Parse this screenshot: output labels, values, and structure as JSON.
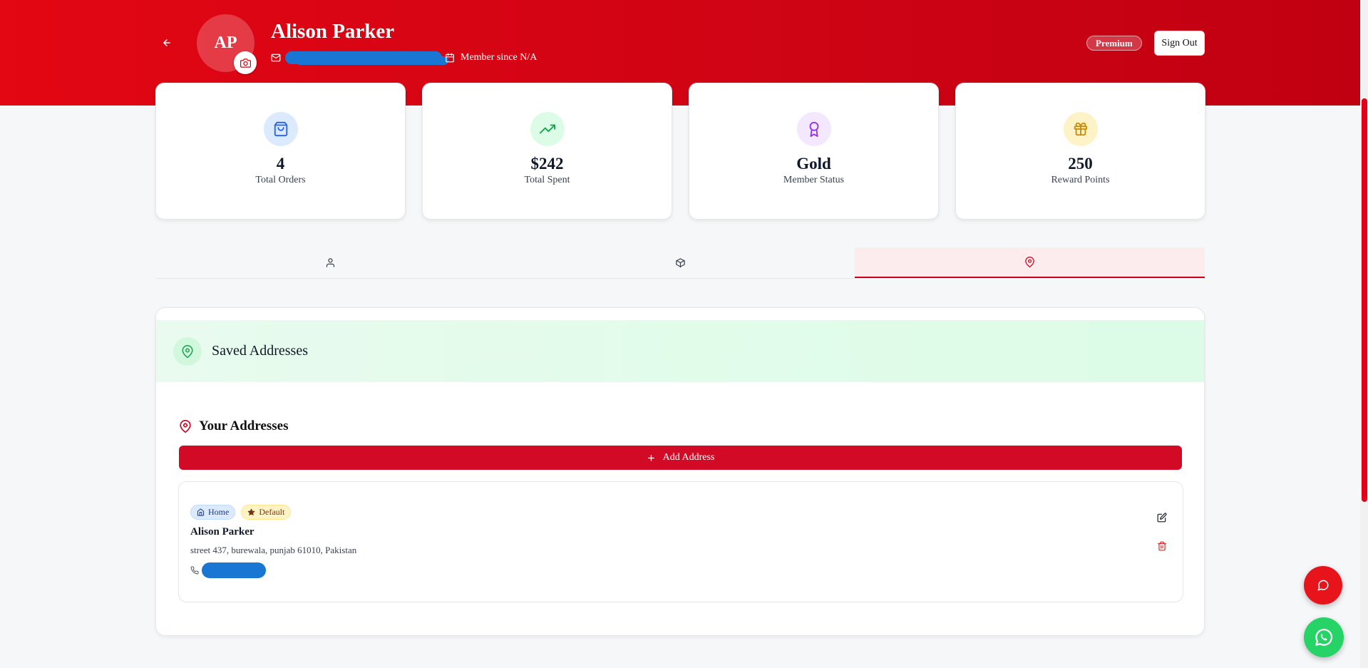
{
  "header": {
    "avatar_initials": "AP",
    "user_name": "Alison Parker",
    "member_since": "Member since N/A",
    "premium_badge": "Premium",
    "sign_out_label": "Sign Out"
  },
  "stats": [
    {
      "value": "4",
      "label": "Total Orders",
      "icon": "shopping-bag-icon",
      "icon_bg": "#dbeafe",
      "icon_color": "#2563eb"
    },
    {
      "value": "$242",
      "label": "Total Spent",
      "icon": "trending-up-icon",
      "icon_bg": "#dcfce7",
      "icon_color": "#16a34a"
    },
    {
      "value": "Gold",
      "label": "Member Status",
      "icon": "award-icon",
      "icon_bg": "#f3e8ff",
      "icon_color": "#9333ea"
    },
    {
      "value": "250",
      "label": "Reward Points",
      "icon": "gift-icon",
      "icon_bg": "#fef3c7",
      "icon_color": "#ca8a04"
    }
  ],
  "tabs": [
    {
      "icon": "user-icon",
      "active": false
    },
    {
      "icon": "package-icon",
      "active": false
    },
    {
      "icon": "map-pin-icon",
      "active": true
    }
  ],
  "addresses_panel": {
    "title": "Saved Addresses",
    "heading": "Your Addresses",
    "add_button_label": "Add Address",
    "items": [
      {
        "type_badge": "Home",
        "default_badge": "Default",
        "name": "Alison Parker",
        "address": "street 437, burewala, punjab 61010, Pakistan"
      }
    ]
  },
  "colors": {
    "brand_red": "#e30613",
    "button_red": "#d20a26",
    "whatsapp_green": "#25d366",
    "redaction_blue": "#1976d2"
  }
}
